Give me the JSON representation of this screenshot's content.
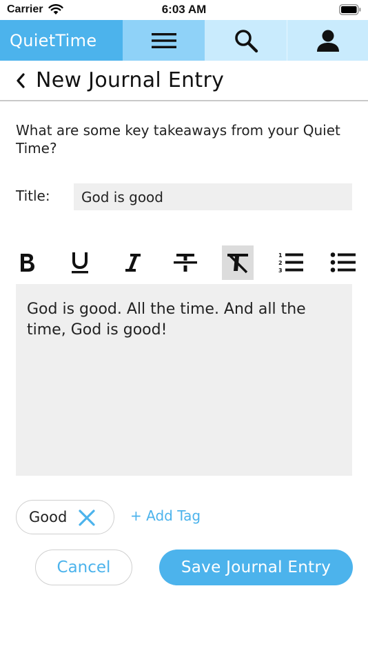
{
  "status_bar": {
    "carrier": "Carrier",
    "time": "6:03 AM",
    "wifi_icon": "wifi-icon",
    "battery_icon": "battery-icon"
  },
  "app_bar": {
    "brand": "QuietTime",
    "menu_icon": "hamburger-menu-icon",
    "search_icon": "search-icon",
    "profile_icon": "person-icon",
    "colors": {
      "brand_bg": "#4cb3ec",
      "menu_bg": "#8fd2f8",
      "search_bg": "#c9ebfd",
      "profile_bg": "#c9ebfd"
    }
  },
  "header": {
    "back_icon": "chevron-left-icon",
    "title": "New Journal Entry"
  },
  "form": {
    "prompt": "What are some key takeaways from your Quiet Time?",
    "title_label": "Title:",
    "title_value": "God is good",
    "toolbar": [
      {
        "name": "bold",
        "icon": "bold-icon",
        "active": false
      },
      {
        "name": "underline",
        "icon": "underline-icon",
        "active": false
      },
      {
        "name": "italic",
        "icon": "italic-icon",
        "active": false
      },
      {
        "name": "strikethrough",
        "icon": "strikethrough-icon",
        "active": false
      },
      {
        "name": "clear-formatting",
        "icon": "clear-format-icon",
        "active": true
      },
      {
        "name": "numbered-list",
        "icon": "numbered-list-icon",
        "active": false
      },
      {
        "name": "bulleted-list",
        "icon": "bulleted-list-icon",
        "active": false
      }
    ],
    "body": "God is good. All the time. And all the time, God is good!"
  },
  "tags": {
    "items": [
      {
        "label": "Good",
        "remove_icon": "close-icon"
      }
    ],
    "add_label": "+ Add Tag"
  },
  "actions": {
    "cancel_label": "Cancel",
    "save_label": "Save Journal Entry",
    "accent_color": "#4cb3ec"
  }
}
